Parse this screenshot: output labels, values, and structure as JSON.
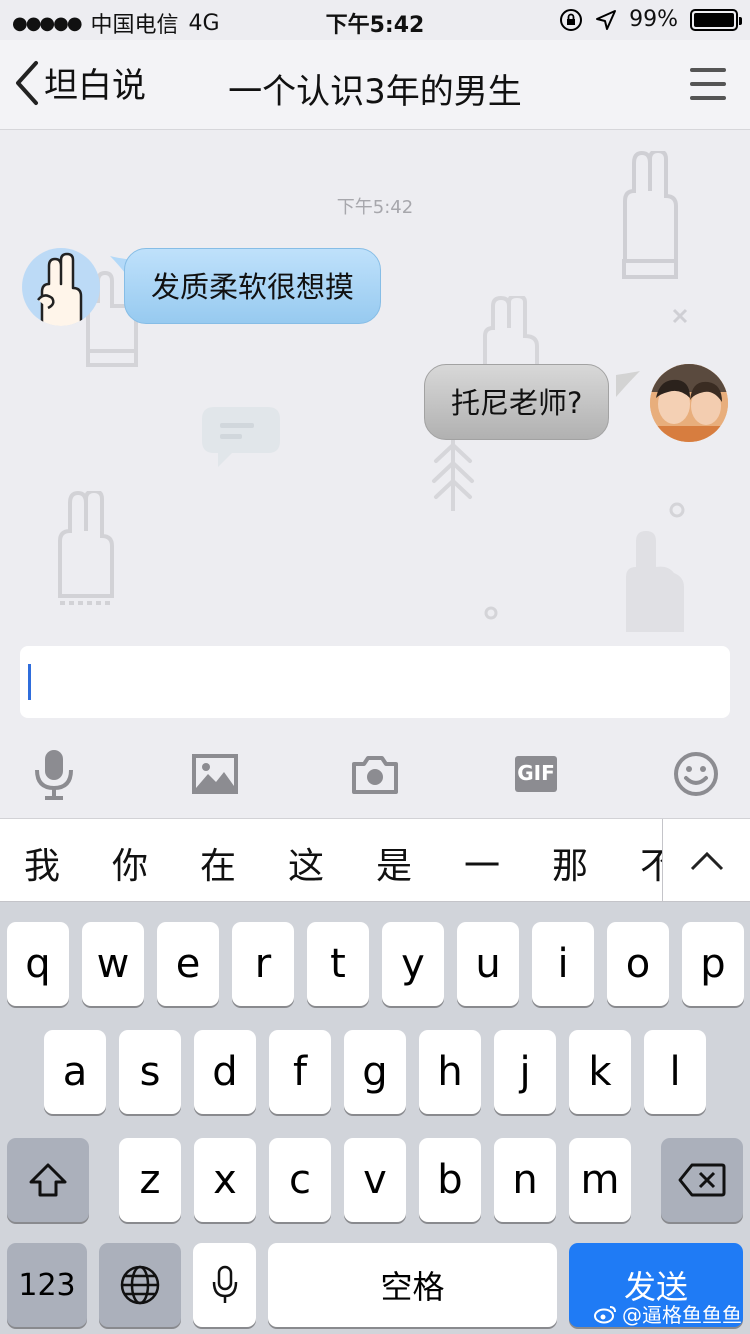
{
  "status_bar": {
    "carrier": "中国电信",
    "network": "4G",
    "time": "下午5:42",
    "battery": "99%",
    "battery_level": 0.99
  },
  "nav": {
    "back_label": "坦白说",
    "title": "一个认识3年的男生"
  },
  "chat": {
    "timestamp": "下午5:42",
    "messages": [
      {
        "direction": "incoming",
        "text": "发质柔软很想摸"
      },
      {
        "direction": "outgoing",
        "text": "托尼老师?"
      }
    ]
  },
  "input": {
    "value": ""
  },
  "toolbar": {
    "icons": [
      "microphone-icon",
      "image-icon",
      "camera-icon",
      "gif-icon",
      "emoji-icon"
    ],
    "gif_label": "GIF"
  },
  "candidates": [
    "我",
    "你",
    "在",
    "这",
    "是",
    "一",
    "那",
    "不"
  ],
  "keyboard": {
    "row1": [
      "q",
      "w",
      "e",
      "r",
      "t",
      "y",
      "u",
      "i",
      "o",
      "p"
    ],
    "row2": [
      "a",
      "s",
      "d",
      "f",
      "g",
      "h",
      "j",
      "k",
      "l"
    ],
    "row3": [
      "z",
      "x",
      "c",
      "v",
      "b",
      "n",
      "m"
    ],
    "numbers_label": "123",
    "space_label": "空格",
    "send_label": "发送"
  },
  "watermark": "@逼格鱼鱼鱼",
  "colors": {
    "incoming_bubble": "#a6d2f4",
    "outgoing_bubble": "#c4c4c4",
    "send_key": "#1f7bf5",
    "caret": "#2f6ddc"
  }
}
